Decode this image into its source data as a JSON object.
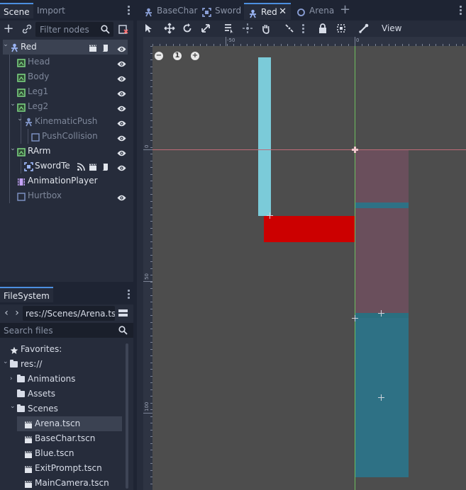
{
  "scene_dock": {
    "tabs": [
      {
        "label": "Scene"
      },
      {
        "label": "Import"
      }
    ],
    "filter_placeholder": "Filter nodes",
    "tree": [
      {
        "label": "Red",
        "depth": 0,
        "expanded": true,
        "icon": "kinematic-body-icon",
        "selected": true,
        "dim": false,
        "extra_icons": [
          "clapperboard-icon",
          "script-icon"
        ]
      },
      {
        "label": "Head",
        "depth": 1,
        "icon": "sprite-icon",
        "dim": true
      },
      {
        "label": "Body",
        "depth": 1,
        "icon": "sprite-icon",
        "dim": true
      },
      {
        "label": "Leg1",
        "depth": 1,
        "icon": "sprite-icon",
        "dim": true
      },
      {
        "label": "Leg2",
        "depth": 1,
        "expanded": true,
        "icon": "sprite-icon",
        "dim": true
      },
      {
        "label": "KinematicPush",
        "depth": 2,
        "expanded": true,
        "icon": "kinematic-body-icon",
        "dim": true
      },
      {
        "label": "PushCollision",
        "depth": 3,
        "icon": "collision-shape-icon",
        "dim": true
      },
      {
        "label": "RArm",
        "depth": 1,
        "expanded": true,
        "icon": "sprite-icon",
        "dim": false
      },
      {
        "label": "SwordTe",
        "depth": 2,
        "icon": "area-icon",
        "dim": false,
        "extra_icons": [
          "signal-icon",
          "clapperboard-icon",
          "script-icon"
        ]
      },
      {
        "label": "AnimationPlayer",
        "depth": 1,
        "icon": "animation-player-icon",
        "dim": false,
        "no_eye": true
      },
      {
        "label": "Hurtbox",
        "depth": 1,
        "icon": "area-outline-icon",
        "dim": true
      }
    ]
  },
  "filesystem": {
    "tab": "FileSystem",
    "path": "res://Scenes/Arena.tscn",
    "search_placeholder": "Search files",
    "items": [
      {
        "label": "Favorites:",
        "depth": 0,
        "icon": "star-icon"
      },
      {
        "label": "res://",
        "depth": 0,
        "icon": "folder-icon",
        "expanded": true
      },
      {
        "label": "Animations",
        "depth": 1,
        "icon": "folder-icon",
        "collapsed": true
      },
      {
        "label": "Assets",
        "depth": 1,
        "icon": "folder-icon"
      },
      {
        "label": "Scenes",
        "depth": 1,
        "icon": "folder-icon",
        "expanded": true
      },
      {
        "label": "Arena.tscn",
        "depth": 2,
        "icon": "scene-file-icon",
        "selected": true
      },
      {
        "label": "BaseChar.tscn",
        "depth": 2,
        "icon": "scene-file-icon"
      },
      {
        "label": "Blue.tscn",
        "depth": 2,
        "icon": "scene-file-icon"
      },
      {
        "label": "ExitPrompt.tscn",
        "depth": 2,
        "icon": "scene-file-icon"
      },
      {
        "label": "MainCamera.tscn",
        "depth": 2,
        "icon": "scene-file-icon"
      }
    ]
  },
  "editor": {
    "tabs": [
      {
        "label": "BaseChar",
        "icon": "kinematic-body-icon",
        "active": false
      },
      {
        "label": "Sword",
        "icon": "area-icon",
        "active": false
      },
      {
        "label": "Red",
        "icon": "kinematic-body-icon",
        "active": true
      },
      {
        "label": "Arena",
        "icon": "node2d-icon",
        "active": false
      }
    ],
    "view_menu": "View",
    "ruler": {
      "top_labels": [
        "-50",
        "0"
      ],
      "left_labels": [
        "0",
        "50",
        "100"
      ]
    },
    "zoom_controls": {
      "zoom_out": "−",
      "reset": "1",
      "zoom_in": "+"
    }
  },
  "colors": {
    "accent": "#4c8fe0",
    "viewport_bg": "#4d4d4d",
    "cyan_sprite": "#7bcbd9",
    "red_sprite": "#cc0000",
    "hurtbox_fill": "#6a4f5c",
    "collision_fill": "#2e7185",
    "x_axis": "#c06a78",
    "y_axis": "#6dbf5e"
  }
}
